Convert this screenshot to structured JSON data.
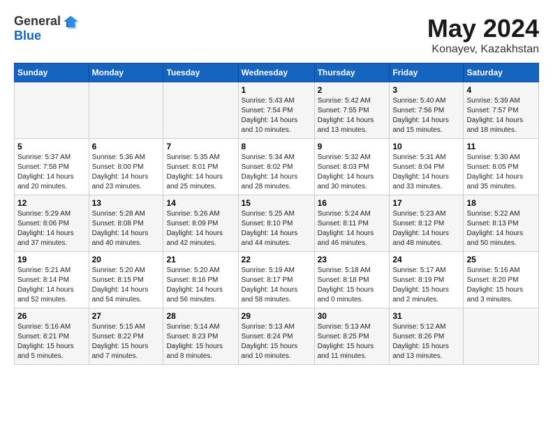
{
  "logo": {
    "general": "General",
    "blue": "Blue"
  },
  "title": "May 2024",
  "subtitle": "Konayev, Kazakhstan",
  "days_header": [
    "Sunday",
    "Monday",
    "Tuesday",
    "Wednesday",
    "Thursday",
    "Friday",
    "Saturday"
  ],
  "weeks": [
    [
      {
        "day": "",
        "info": ""
      },
      {
        "day": "",
        "info": ""
      },
      {
        "day": "",
        "info": ""
      },
      {
        "day": "1",
        "info": "Sunrise: 5:43 AM\nSunset: 7:54 PM\nDaylight: 14 hours\nand 10 minutes."
      },
      {
        "day": "2",
        "info": "Sunrise: 5:42 AM\nSunset: 7:55 PM\nDaylight: 14 hours\nand 13 minutes."
      },
      {
        "day": "3",
        "info": "Sunrise: 5:40 AM\nSunset: 7:56 PM\nDaylight: 14 hours\nand 15 minutes."
      },
      {
        "day": "4",
        "info": "Sunrise: 5:39 AM\nSunset: 7:57 PM\nDaylight: 14 hours\nand 18 minutes."
      }
    ],
    [
      {
        "day": "5",
        "info": "Sunrise: 5:37 AM\nSunset: 7:58 PM\nDaylight: 14 hours\nand 20 minutes."
      },
      {
        "day": "6",
        "info": "Sunrise: 5:36 AM\nSunset: 8:00 PM\nDaylight: 14 hours\nand 23 minutes."
      },
      {
        "day": "7",
        "info": "Sunrise: 5:35 AM\nSunset: 8:01 PM\nDaylight: 14 hours\nand 25 minutes."
      },
      {
        "day": "8",
        "info": "Sunrise: 5:34 AM\nSunset: 8:02 PM\nDaylight: 14 hours\nand 28 minutes."
      },
      {
        "day": "9",
        "info": "Sunrise: 5:32 AM\nSunset: 8:03 PM\nDaylight: 14 hours\nand 30 minutes."
      },
      {
        "day": "10",
        "info": "Sunrise: 5:31 AM\nSunset: 8:04 PM\nDaylight: 14 hours\nand 33 minutes."
      },
      {
        "day": "11",
        "info": "Sunrise: 5:30 AM\nSunset: 8:05 PM\nDaylight: 14 hours\nand 35 minutes."
      }
    ],
    [
      {
        "day": "12",
        "info": "Sunrise: 5:29 AM\nSunset: 8:06 PM\nDaylight: 14 hours\nand 37 minutes."
      },
      {
        "day": "13",
        "info": "Sunrise: 5:28 AM\nSunset: 8:08 PM\nDaylight: 14 hours\nand 40 minutes."
      },
      {
        "day": "14",
        "info": "Sunrise: 5:26 AM\nSunset: 8:09 PM\nDaylight: 14 hours\nand 42 minutes."
      },
      {
        "day": "15",
        "info": "Sunrise: 5:25 AM\nSunset: 8:10 PM\nDaylight: 14 hours\nand 44 minutes."
      },
      {
        "day": "16",
        "info": "Sunrise: 5:24 AM\nSunset: 8:11 PM\nDaylight: 14 hours\nand 46 minutes."
      },
      {
        "day": "17",
        "info": "Sunrise: 5:23 AM\nSunset: 8:12 PM\nDaylight: 14 hours\nand 48 minutes."
      },
      {
        "day": "18",
        "info": "Sunrise: 5:22 AM\nSunset: 8:13 PM\nDaylight: 14 hours\nand 50 minutes."
      }
    ],
    [
      {
        "day": "19",
        "info": "Sunrise: 5:21 AM\nSunset: 8:14 PM\nDaylight: 14 hours\nand 52 minutes."
      },
      {
        "day": "20",
        "info": "Sunrise: 5:20 AM\nSunset: 8:15 PM\nDaylight: 14 hours\nand 54 minutes."
      },
      {
        "day": "21",
        "info": "Sunrise: 5:20 AM\nSunset: 8:16 PM\nDaylight: 14 hours\nand 56 minutes."
      },
      {
        "day": "22",
        "info": "Sunrise: 5:19 AM\nSunset: 8:17 PM\nDaylight: 14 hours\nand 58 minutes."
      },
      {
        "day": "23",
        "info": "Sunrise: 5:18 AM\nSunset: 8:18 PM\nDaylight: 15 hours\nand 0 minutes."
      },
      {
        "day": "24",
        "info": "Sunrise: 5:17 AM\nSunset: 8:19 PM\nDaylight: 15 hours\nand 2 minutes."
      },
      {
        "day": "25",
        "info": "Sunrise: 5:16 AM\nSunset: 8:20 PM\nDaylight: 15 hours\nand 3 minutes."
      }
    ],
    [
      {
        "day": "26",
        "info": "Sunrise: 5:16 AM\nSunset: 8:21 PM\nDaylight: 15 hours\nand 5 minutes."
      },
      {
        "day": "27",
        "info": "Sunrise: 5:15 AM\nSunset: 8:22 PM\nDaylight: 15 hours\nand 7 minutes."
      },
      {
        "day": "28",
        "info": "Sunrise: 5:14 AM\nSunset: 8:23 PM\nDaylight: 15 hours\nand 8 minutes."
      },
      {
        "day": "29",
        "info": "Sunrise: 5:13 AM\nSunset: 8:24 PM\nDaylight: 15 hours\nand 10 minutes."
      },
      {
        "day": "30",
        "info": "Sunrise: 5:13 AM\nSunset: 8:25 PM\nDaylight: 15 hours\nand 11 minutes."
      },
      {
        "day": "31",
        "info": "Sunrise: 5:12 AM\nSunset: 8:26 PM\nDaylight: 15 hours\nand 13 minutes."
      },
      {
        "day": "",
        "info": ""
      }
    ]
  ]
}
